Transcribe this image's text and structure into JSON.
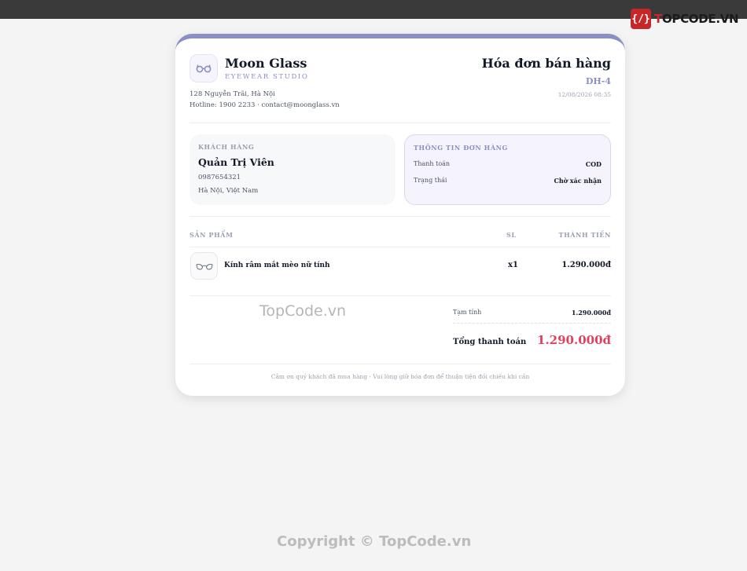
{
  "watermark": {
    "logo_mark": "{/}",
    "logo_prefix": "T",
    "logo_rest": "OPCODE.VN",
    "center_text": "TopCode.vn",
    "footer_text": "Copyright © TopCode.vn"
  },
  "shop": {
    "icon": "glasses-icon",
    "name": "Moon Glass",
    "tagline": "EYEWEAR STUDIO",
    "address": "128 Nguyễn Trãi, Hà Nội",
    "contact": "Hotline: 1900 2233 · contact@moonglass.vn"
  },
  "invoice": {
    "title": "Hóa đơn bán hàng",
    "code": "DH-4",
    "datetime": "12/08/2026 08:35"
  },
  "customer": {
    "section_label": "KHÁCH HÀNG",
    "name": "Quản Trị Viên",
    "phone": "0987654321",
    "address": "Hà Nội, Việt Nam"
  },
  "order_info": {
    "section_label": "THÔNG TIN ĐƠN HÀNG",
    "payment_label": "Thanh toán",
    "payment_value": "COD",
    "status_label": "Trạng thái",
    "status_value": "Chờ xác nhận"
  },
  "table": {
    "col_product": "SẢN PHẨM",
    "col_qty": "SL",
    "col_total": "THÀNH TIỀN",
    "rows": [
      {
        "icon": "sunglasses-icon",
        "name": "Kính râm mắt mèo nữ tính",
        "qty": "x1",
        "total": "1.290.000đ"
      }
    ]
  },
  "summary": {
    "subtotal_label": "Tạm tính",
    "subtotal_value": "1.290.000đ",
    "grand_total_label": "Tổng thanh toán",
    "grand_total_value": "1.290.000đ"
  },
  "footer_note": "Cảm ơn quý khách đã mua hàng · Vui lòng giữ hóa đơn để thuận tiện đối chiếu khi cần",
  "colors": {
    "accent": "#8a8fc4",
    "total_red": "#e0415f",
    "topbar": "#3a3a3a",
    "page_bg": "#f4f4f4"
  }
}
